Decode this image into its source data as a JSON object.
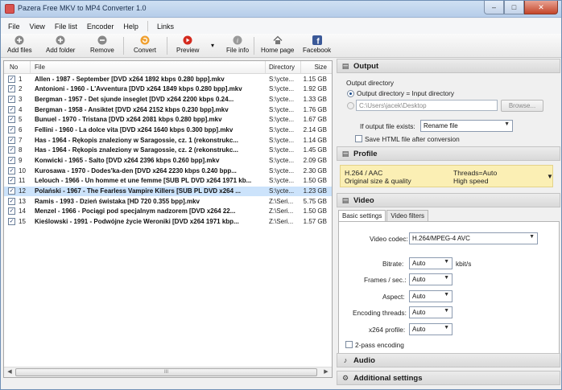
{
  "window": {
    "title": "Pazera Free MKV to MP4 Converter 1.0",
    "controls": [
      "–",
      "□",
      "✕"
    ]
  },
  "menu": [
    "File",
    "View",
    "File list",
    "Encoder",
    "Help",
    "Links"
  ],
  "toolbar": {
    "add_files": "Add files",
    "add_folder": "Add folder",
    "remove": "Remove",
    "convert": "Convert",
    "preview": "Preview",
    "preview_arrow": "▾",
    "file_info": "File info",
    "home_page": "Home page",
    "facebook": "Facebook"
  },
  "list": {
    "headers": {
      "no": "No",
      "file": "File",
      "directory": "Directory",
      "size": "Size"
    },
    "rows": [
      {
        "no": "1",
        "file": "Allen - 1987 - September [DVD x264 1892 kbps 0.280 bpp].mkv",
        "dir": "S:\\ycte...",
        "size": "1.15 GB",
        "checked": "✓"
      },
      {
        "no": "2",
        "file": "Antonioni - 1960 - L'Avventura [DVD x264 1849 kbps 0.280 bpp].mkv",
        "dir": "S:\\ycte...",
        "size": "1.92 GB",
        "checked": "✓"
      },
      {
        "no": "3",
        "file": "Bergman - 1957 - Det sjunde inseglet [DVD x264 2200 kbps 0.24...",
        "dir": "S:\\ycte...",
        "size": "1.33 GB",
        "checked": "✓"
      },
      {
        "no": "4",
        "file": "Bergman - 1958 - Ansiktet [DVD x264 2152 kbps 0.230 bpp].mkv",
        "dir": "S:\\ycte...",
        "size": "1.76 GB",
        "checked": "✓"
      },
      {
        "no": "5",
        "file": "Bunuel - 1970 - Tristana [DVD x264 2081 kbps 0.280 bpp].mkv",
        "dir": "S:\\ycte...",
        "size": "1.67 GB",
        "checked": "✓"
      },
      {
        "no": "6",
        "file": "Fellini - 1960 - La dolce vita [DVD x264 1640 kbps 0.300 bpp].mkv",
        "dir": "S:\\ycte...",
        "size": "2.14 GB",
        "checked": "✓"
      },
      {
        "no": "7",
        "file": "Has - 1964 - Rękopis znaleziony w Saragossie, cz. 1 (rekonstrukc...",
        "dir": "S:\\ycte...",
        "size": "1.14 GB",
        "checked": "✓"
      },
      {
        "no": "8",
        "file": "Has - 1964 - Rękopis znaleziony w Saragossie, cz. 2 (rekonstrukc...",
        "dir": "S:\\ycte...",
        "size": "1.45 GB",
        "checked": "✓"
      },
      {
        "no": "9",
        "file": "Konwicki - 1965 - Salto [DVD x264 2396 kbps 0.260 bpp].mkv",
        "dir": "S:\\ycte...",
        "size": "2.09 GB",
        "checked": "✓"
      },
      {
        "no": "10",
        "file": "Kurosawa - 1970 - Dodes'ka-den [DVD x264 2230 kbps 0.240 bpp...",
        "dir": "S:\\ycte...",
        "size": "2.30 GB",
        "checked": "✓"
      },
      {
        "no": "11",
        "file": "Lelouch - 1966 - Un homme et une femme [SUB PL DVD x264 1971 kb...",
        "dir": "S:\\ycte...",
        "size": "1.50 GB",
        "checked": "✓"
      },
      {
        "no": "12",
        "file": "Polański - 1967 - The Fearless Vampire Killers [SUB PL DVD x264 ...",
        "dir": "S:\\ycte...",
        "size": "1.23 GB",
        "checked": "✓"
      },
      {
        "no": "13",
        "file": "Ramis - 1993 - Dzień świstaka [HD 720 0.355 bpp].mkv",
        "dir": "Z:\\Seri...",
        "size": "5.75 GB",
        "checked": "✓"
      },
      {
        "no": "14",
        "file": "Menzel - 1966 - Pociągi pod specjalnym nadzorem [DVD x264 22...",
        "dir": "Z:\\Seri...",
        "size": "1.50 GB",
        "checked": "✓"
      },
      {
        "no": "15",
        "file": "Kieślowski - 1991 - Podwójne życie Weroniki [DVD x264 1971 kbp...",
        "dir": "Z:\\Seri...",
        "size": "1.57 GB",
        "checked": "✓"
      }
    ],
    "selected_row": 12,
    "scroll_grip": "III"
  },
  "output": {
    "header": "Output",
    "section_label": "Output directory",
    "radio_input_dir": "Output directory = Input directory",
    "dir_value": "C:\\Users\\jacek\\Desktop",
    "browse": "Browse...",
    "exists_label": "If output file exists:",
    "exists_value": "Rename file",
    "save_html": "Save HTML file after conversion"
  },
  "profile": {
    "header": "Profile",
    "line1_left": "H.264 / AAC",
    "line1_right": "Threads=Auto",
    "line2_left": "Original size & quality",
    "line2_right": "High speed"
  },
  "video": {
    "header": "Video",
    "tabs": [
      "Basic settings",
      "Video filters"
    ],
    "codec_label": "Video codec:",
    "codec_value": "H.264/MPEG-4 AVC",
    "bitrate_label": "Bitrate:",
    "bitrate_value": "Auto",
    "bitrate_unit": "kbit/s",
    "fps_label": "Frames / sec.:",
    "fps_value": "Auto",
    "aspect_label": "Aspect:",
    "aspect_value": "Auto",
    "threads_label": "Encoding threads:",
    "threads_value": "Auto",
    "profile_label": "x264 profile:",
    "profile_value": "Auto",
    "twopass": "2-pass encoding"
  },
  "audio": {
    "header": "Audio"
  },
  "additional": {
    "header": "Additional settings"
  },
  "colors": {
    "selection": "#cce3fb",
    "profile_bg": "#fbefb4",
    "convert_icon": "#f0a030",
    "preview_icon": "#d42a1e"
  }
}
